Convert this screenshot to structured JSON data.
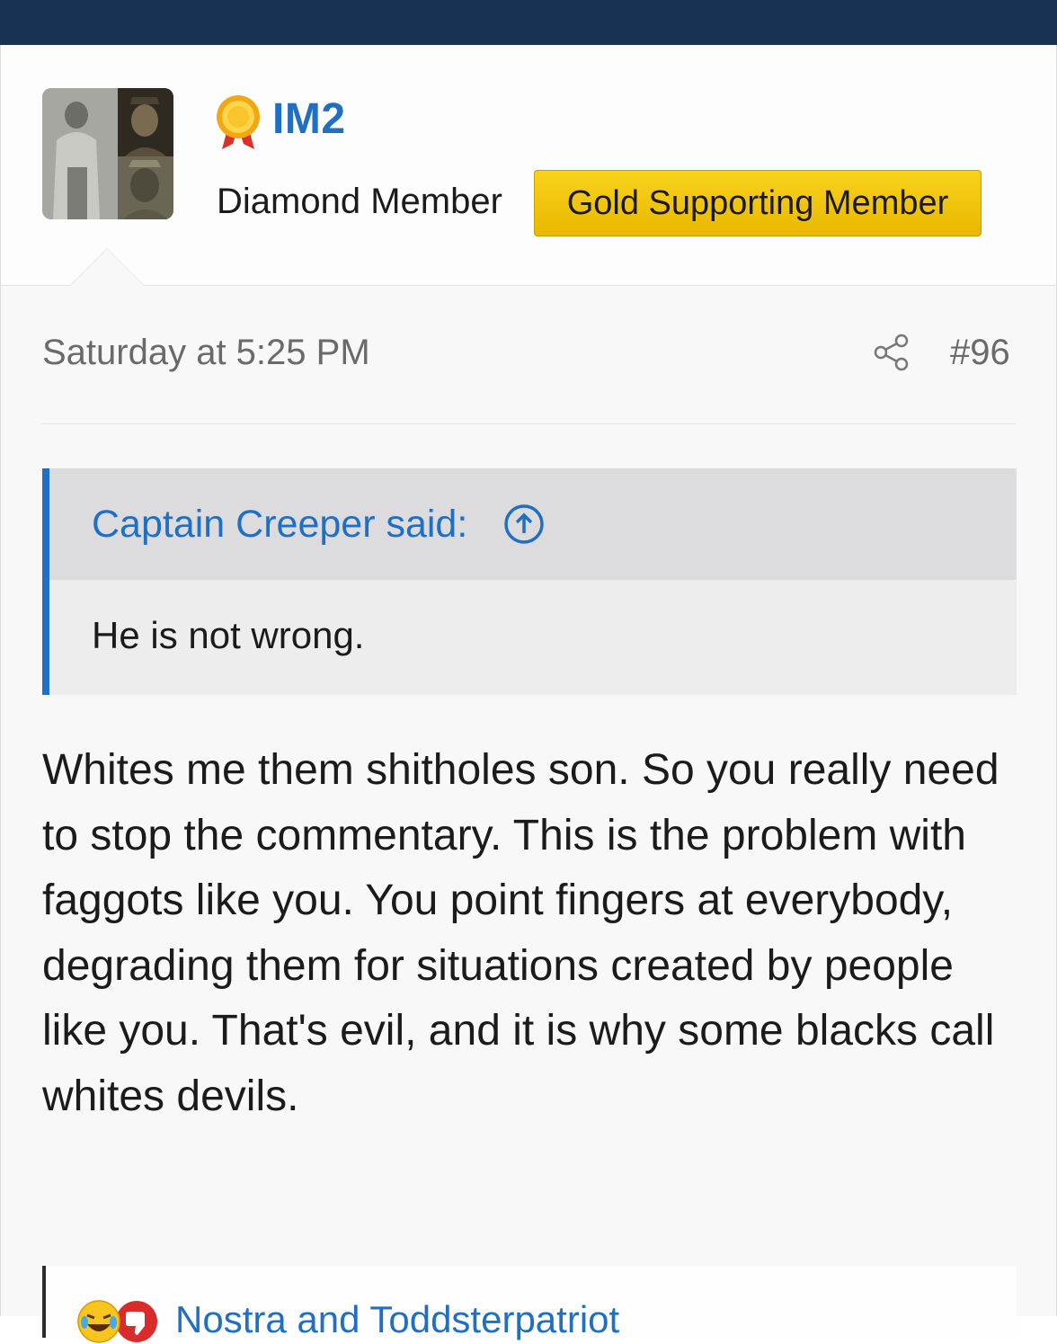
{
  "user": {
    "username": "IM2",
    "title": "Diamond Member",
    "banner": "Gold Supporting Member"
  },
  "post": {
    "date": "Saturday at 5:25 PM",
    "number": "#96",
    "quote": {
      "author_label": "Captain Creeper said:",
      "text": "He is not wrong."
    },
    "message": "Whites me them shitholes son. So you really need to stop the commentary. This is the problem with faggots like you. You point fingers at everybody, degrading them for situations created by people like you. That's evil, and it is why some blacks call whites devils.",
    "reactions": {
      "icons": [
        "laugh-emoji-icon",
        "dislike-icon"
      ],
      "names": "Nostra and Toddsterpatriot"
    }
  },
  "colors": {
    "topbar": "#183254",
    "link_blue": "#1f6fc4",
    "banner_gold": "#f5c400"
  }
}
